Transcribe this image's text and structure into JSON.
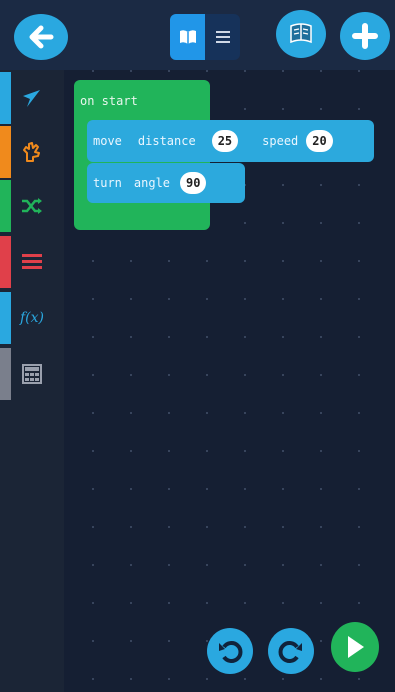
{
  "blocks": {
    "start": {
      "label": "on start"
    },
    "move": {
      "keyword": "move",
      "param1_label": "distance",
      "param1_value": "25",
      "param2_label": "speed",
      "param2_value": "20"
    },
    "turn": {
      "keyword": "turn",
      "param1_label": "angle",
      "param1_value": "90"
    }
  },
  "toolbox": {
    "categories": [
      {
        "name": "Movement",
        "icon": "navigation-arrow-icon",
        "color": "#2aa8e0"
      },
      {
        "name": "Hands",
        "icon": "glove-hand-icon",
        "color": "#f08a1c"
      },
      {
        "name": "Logic",
        "icon": "shuffle-icon",
        "color": "#21b45a"
      },
      {
        "name": "Loops",
        "icon": "list-bars-icon",
        "color": "#e0404a"
      },
      {
        "name": "Functions",
        "icon": "function-fx-icon",
        "color": "#2aa8e0"
      },
      {
        "name": "Math",
        "icon": "calculator-icon",
        "color": "#7a7f8c"
      }
    ],
    "function_glyph": "f(x)"
  },
  "topbar": {
    "back_icon": "back-arrow-icon",
    "view_blocks_icon": "book-open-icon",
    "view_text_icon": "text-lines-icon",
    "library_icon": "book-stack-icon",
    "add_icon": "plus-icon",
    "accent": "#2aa8e0"
  },
  "controls": {
    "undo_icon": "undo-icon",
    "redo_icon": "redo-icon",
    "run_icon": "play-icon"
  }
}
